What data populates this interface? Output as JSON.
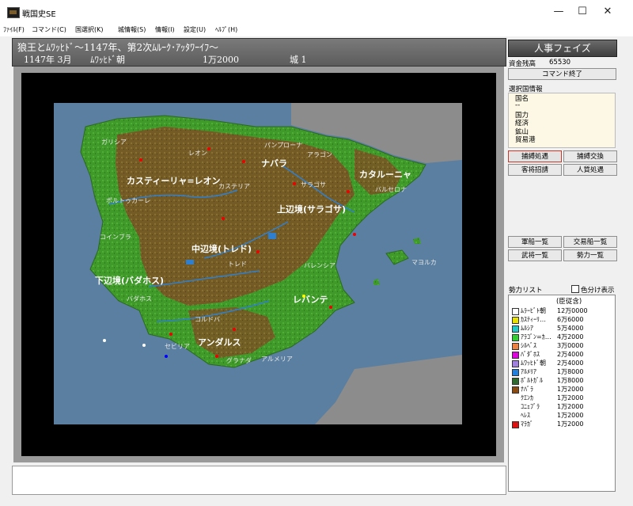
{
  "window": {
    "title": "戦国史SE",
    "minimize": "—",
    "maximize": "☐",
    "close": "✕"
  },
  "menu": [
    "ﾌｧｲﾙ(F)",
    "コマンド(C)",
    "国選択(K)",
    "城情報(S)",
    "情報(I)",
    "設定(U)",
    "ﾍﾙﾌﾟ(H)"
  ],
  "status": {
    "scenario": "狼王とﾑﾜｯﾋﾄﾞ～1147年、第2次ﾑﾙｰｸ･ｱｯﾀﾜｰｲﾌ～",
    "date": "1147年 3月",
    "faction": "ﾑﾜｯﾋﾄﾞ朝",
    "amount": "1万2000",
    "castle": "城 1"
  },
  "side": {
    "phase": "人事フェイズ",
    "funds_label": "資金残高",
    "funds_value": "65530",
    "end_command": "コマンド終了",
    "info_header": "選択国情報",
    "info_rows": [
      "国名",
      "--",
      "国力",
      "経済",
      "鉱山",
      "貿易港"
    ],
    "buttons1": [
      "捕縛処遇",
      "捕縛交換",
      "客将招請",
      "人質処遇"
    ],
    "buttons2": [
      "軍船一覧",
      "交易船一覧",
      "武将一覧",
      "勢力一覧"
    ],
    "force_list_label": "勢力リスト",
    "color_display": "色分け表示",
    "force_header": "(臣従含)",
    "forces": [
      {
        "name": "ﾑﾗｰﾋﾞﾄ朝",
        "value": "12万0000",
        "color": "#ffffff"
      },
      {
        "name": "ｶｽﾃｨｰﾘ…",
        "value": "6万6000",
        "color": "#e8e000"
      },
      {
        "name": "ﾑﾙｼｱ",
        "value": "5万4000",
        "color": "#20c8c8"
      },
      {
        "name": "ｱﾗｺﾞﾝ=ｶ…",
        "value": "4万2000",
        "color": "#30d030"
      },
      {
        "name": "ｼﾙﾍﾞｽ",
        "value": "3万0000",
        "color": "#f08040"
      },
      {
        "name": "ﾊﾞﾀﾞﾎｽ",
        "value": "2万4000",
        "color": "#e000e0"
      },
      {
        "name": "ﾑﾜｯﾋﾄﾞ朝",
        "value": "2万4000",
        "color": "#a080e0"
      },
      {
        "name": "ｱﾙﾒﾘｱ",
        "value": "1万8000",
        "color": "#2080e0"
      },
      {
        "name": "ﾎﾟﾙﾄｶﾞﾙ",
        "value": "1万8000",
        "color": "#2e6b2e"
      },
      {
        "name": "ﾅﾊﾞﾗ",
        "value": "1万2000",
        "color": "#8a4a10"
      },
      {
        "name": "ｸｴﾝｶ",
        "value": "1万2000",
        "color": ""
      },
      {
        "name": "ｺﾆｪﾌﾞﾗ",
        "value": "1万2000",
        "color": ""
      },
      {
        "name": "ﾍﾚｽ",
        "value": "1万2000",
        "color": ""
      },
      {
        "name": "ﾏﾗｶﾞ",
        "value": "1万2000",
        "color": "#e01010"
      }
    ]
  },
  "map": {
    "regions": [
      {
        "id": "castilla-leon",
        "text": "カスティーリャ=レオン"
      },
      {
        "id": "navarra",
        "text": "ナバラ"
      },
      {
        "id": "cataluna",
        "text": "カタルーニャ"
      },
      {
        "id": "upper-march",
        "text": "上辺境(サラゴサ)"
      },
      {
        "id": "middle-march",
        "text": "中辺境(トレド)"
      },
      {
        "id": "lower-march",
        "text": "下辺境(バダホス)"
      },
      {
        "id": "levante",
        "text": "レバンテ"
      },
      {
        "id": "andalus",
        "text": "アンダルス"
      }
    ],
    "cities": [
      {
        "id": "galicia",
        "text": "ガリシア"
      },
      {
        "id": "leon",
        "text": "レオン"
      },
      {
        "id": "pamplona",
        "text": "パンプローナ"
      },
      {
        "id": "aragon",
        "text": "アラゴン"
      },
      {
        "id": "castilla",
        "text": "カステリア"
      },
      {
        "id": "zaragoza",
        "text": "サラゴサ"
      },
      {
        "id": "barcelona",
        "text": "バルセロナ"
      },
      {
        "id": "portucale",
        "text": "ポルトゥカーレ"
      },
      {
        "id": "coimbra",
        "text": "コインブラ"
      },
      {
        "id": "toledo",
        "text": "トレド"
      },
      {
        "id": "valencia",
        "text": "バレンシア"
      },
      {
        "id": "mallorca",
        "text": "マヨルカ"
      },
      {
        "id": "badajoz",
        "text": "バダホス"
      },
      {
        "id": "cordoba",
        "text": "コルドバ"
      },
      {
        "id": "sevilla",
        "text": "セビリア"
      },
      {
        "id": "granada",
        "text": "グラナダ"
      },
      {
        "id": "almeria",
        "text": "アルメリア"
      }
    ]
  }
}
